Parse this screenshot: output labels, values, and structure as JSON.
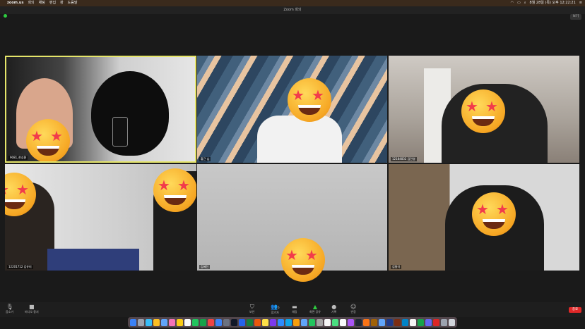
{
  "menubar": {
    "apple": "",
    "items": [
      "zoom.us",
      "회의",
      "채팅",
      "편집",
      "창",
      "도움말"
    ],
    "clock": "8월 28일 (목) 오후 12:22:21"
  },
  "window": {
    "title": "Zoom 회의",
    "view_label": "보기"
  },
  "tiles": [
    {
      "name": "9081_한승환"
    },
    {
      "name": "황근 님"
    },
    {
      "name": "12184832 김민영"
    },
    {
      "name": "12201712 김유미"
    },
    {
      "name": "김혜진"
    },
    {
      "name": "김형석"
    }
  ],
  "toolbar": {
    "mute": "음소거",
    "video": "비디오 중지",
    "security": "보안",
    "participants": "참가자",
    "participants_count": "6",
    "chat": "채팅",
    "share": "화면 공유",
    "record": "기록",
    "reactions": "반응",
    "end": "종료"
  },
  "colors": {
    "active_speaker_border": "#e5e56a",
    "end_button": "#e02828"
  }
}
